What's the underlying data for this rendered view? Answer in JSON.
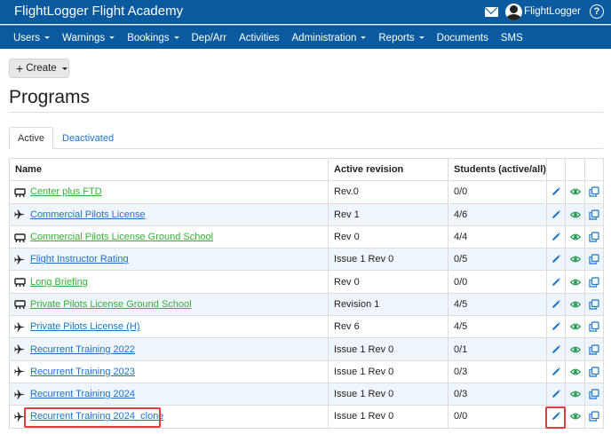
{
  "header": {
    "brand": "FlightLogger Flight Academy",
    "user": "FlightLogger",
    "help_label": "?"
  },
  "nav": [
    {
      "label": "Users",
      "dropdown": true
    },
    {
      "label": "Warnings",
      "dropdown": true
    },
    {
      "label": "Bookings",
      "dropdown": true
    },
    {
      "label": "Dep/Arr",
      "dropdown": false
    },
    {
      "label": "Activities",
      "dropdown": false
    },
    {
      "label": "Administration",
      "dropdown": true
    },
    {
      "label": "Reports",
      "dropdown": true
    },
    {
      "label": "Documents",
      "dropdown": false
    },
    {
      "label": "SMS",
      "dropdown": false
    }
  ],
  "create_button": {
    "plus": "+",
    "label": "Create"
  },
  "page_title": "Programs",
  "tabs": {
    "active": "Active",
    "other": "Deactivated"
  },
  "table": {
    "headers": {
      "name": "Name",
      "revision": "Active revision",
      "students": "Students (active/all)"
    },
    "rows": [
      {
        "type": "simulator-icon",
        "name": "Center plus FTD",
        "color": "green",
        "revision": "Rev.0",
        "students": "0/0"
      },
      {
        "type": "airplane-icon",
        "name": "Commercial Pilots License",
        "color": "blue",
        "revision": "Rev 1",
        "students": "4/6"
      },
      {
        "type": "simulator-icon",
        "name": "Commercial Pilots License Ground School",
        "color": "green",
        "revision": "Rev 0",
        "students": "4/4"
      },
      {
        "type": "airplane-icon",
        "name": "Flight Instructor Rating",
        "color": "blue",
        "revision": "Issue 1 Rev 0",
        "students": "0/5"
      },
      {
        "type": "simulator-icon",
        "name": "Long Briefing",
        "color": "green",
        "revision": "Rev 0",
        "students": "0/0"
      },
      {
        "type": "simulator-icon",
        "name": "Private Pilots License Ground School",
        "color": "green",
        "revision": "Revision 1",
        "students": "4/5"
      },
      {
        "type": "airplane-icon",
        "name": "Private Pilots License (H)",
        "color": "blue",
        "revision": "Rev 6",
        "students": "4/5"
      },
      {
        "type": "airplane-icon",
        "name": "Recurrent Training 2022",
        "color": "blue",
        "revision": "Issue 1 Rev 0",
        "students": "0/1"
      },
      {
        "type": "airplane-icon",
        "name": "Recurrent Training 2023",
        "color": "blue",
        "revision": "Issue 1 Rev 0",
        "students": "0/3"
      },
      {
        "type": "airplane-icon",
        "name": "Recurrent Training 2024",
        "color": "blue",
        "revision": "Issue 1 Rev 0",
        "students": "0/3"
      },
      {
        "type": "airplane-icon",
        "name": "Recurrent Training 2024_clone",
        "color": "blue",
        "revision": "Issue 1 Rev 0",
        "students": "0/0"
      }
    ]
  },
  "colors": {
    "header_bg": "#0a5aa0",
    "link_blue": "#1a74c8",
    "link_green": "#34b334",
    "icon_green": "#2e9b5b",
    "highlight": "#e23b3b"
  }
}
